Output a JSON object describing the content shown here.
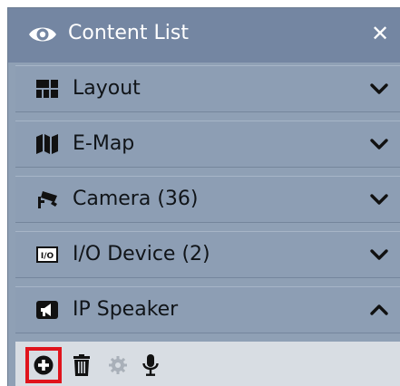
{
  "panel": {
    "title": "Content List",
    "title_icon": "eye-icon",
    "close_label": "✕"
  },
  "sections": [
    {
      "id": "layout",
      "label": "Layout",
      "icon": "layout-grid-icon",
      "expanded": false
    },
    {
      "id": "emap",
      "label": "E-Map",
      "icon": "map-icon",
      "expanded": false
    },
    {
      "id": "camera",
      "label": "Camera (36)",
      "icon": "camera-icon",
      "expanded": false
    },
    {
      "id": "io-device",
      "label": "I/O Device (2)",
      "icon": "io-device-icon",
      "expanded": false
    },
    {
      "id": "ip-speaker",
      "label": "IP Speaker",
      "icon": "megaphone-icon",
      "expanded": true
    }
  ],
  "toolbar": {
    "buttons": [
      {
        "name": "add-button",
        "icon": "plus-circle-icon",
        "highlighted": true
      },
      {
        "name": "delete-button",
        "icon": "trash-icon",
        "enabled": true
      },
      {
        "name": "settings-button",
        "icon": "gear-icon",
        "enabled": false
      },
      {
        "name": "microphone-button",
        "icon": "microphone-icon",
        "enabled": true
      }
    ],
    "highlight_color": "#e0141c"
  }
}
